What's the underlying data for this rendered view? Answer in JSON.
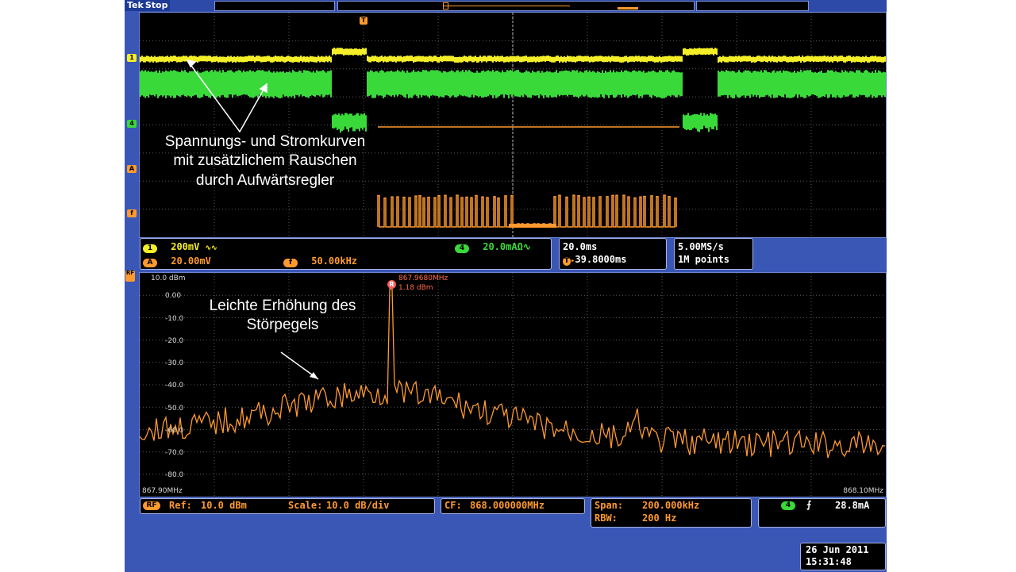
{
  "header": {
    "brand": "Tek",
    "status": "Stop"
  },
  "time_domain": {
    "annotation_lines": [
      "Spannungs- und Stromkurven",
      "mit zusätzlichem Rauschen",
      "durch Aufwärtsregler"
    ],
    "channel_markers": [
      "1",
      "4",
      "A",
      "f"
    ],
    "trigger_marker": "T",
    "colors": {
      "ch1": "#f4ee28",
      "ch4": "#3ad93a",
      "math": "#ff9a2e"
    }
  },
  "readouts": {
    "ch1_label": "1",
    "ch1_scale": "200mV",
    "ch1_coupling": "∿∿",
    "ch4_label": "4",
    "ch4_scale": "20.0mAΩ∿",
    "math_a_label": "A",
    "math_a_scale": "20.00mV",
    "math_f_label": "f",
    "math_f_value": "50.00kHz",
    "timebase": "20.0ms",
    "trigger_position": "39.8000ms",
    "sample_rate": "5.00MS/s",
    "record_length": "1M points"
  },
  "spectrum": {
    "side_marker": "RF",
    "y_labels": [
      "10.0 dBm",
      "0.00",
      "-10.0",
      "-20.0",
      "-30.0",
      "-40.0",
      "-50.0",
      "-60.0",
      "-70.0",
      "-80.0"
    ],
    "marker_label": "R",
    "marker_freq": "867.9680MHz",
    "marker_level": "1.18 dBm",
    "start_freq": "867.90MHz",
    "stop_freq": "868.10MHz",
    "annotation_lines": [
      "Leichte Erhöhung des",
      "Störpegels"
    ]
  },
  "footer": {
    "rf_badge": "RF",
    "ref_label": "Ref:",
    "ref_value": "10.0 dBm",
    "scale_label": "Scale:",
    "scale_value": "10.0 dB/div",
    "cf_label": "CF:",
    "cf_value": "868.000000MHz",
    "span_label": "Span:",
    "span_value": "200.000kHz",
    "rbw_label": "RBW:",
    "rbw_value": "200 Hz",
    "trig_ch": "4",
    "trig_level": "28.8mA",
    "date": "26 Jun 2011",
    "time": "15:31:48"
  }
}
